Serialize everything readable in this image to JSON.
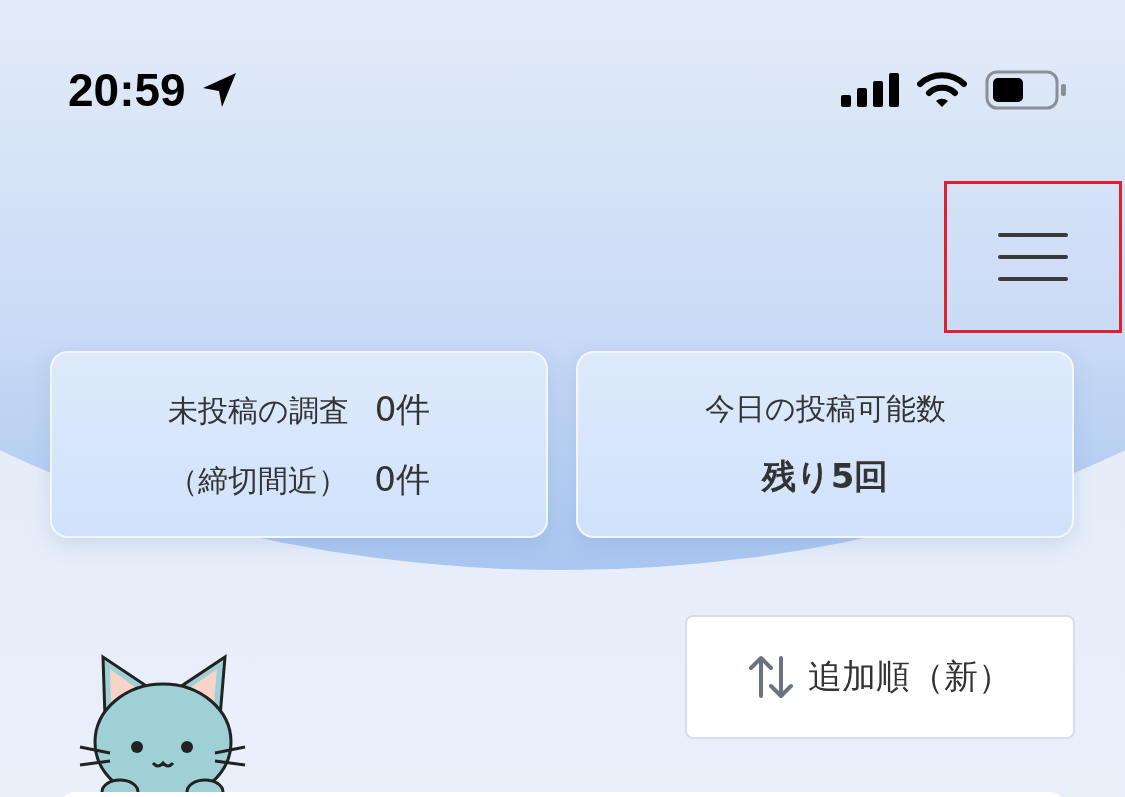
{
  "status_bar": {
    "time": "20:59"
  },
  "stat_cards": [
    {
      "kind": "counts",
      "rows": [
        {
          "label": "未投稿の調査",
          "value": "0件"
        },
        {
          "label": "（締切間近）",
          "value": "0件"
        }
      ]
    },
    {
      "kind": "remaining",
      "title": "今日の投稿可能数",
      "value": "残り5回"
    }
  ],
  "sort_button": {
    "label": "追加順（新）"
  }
}
